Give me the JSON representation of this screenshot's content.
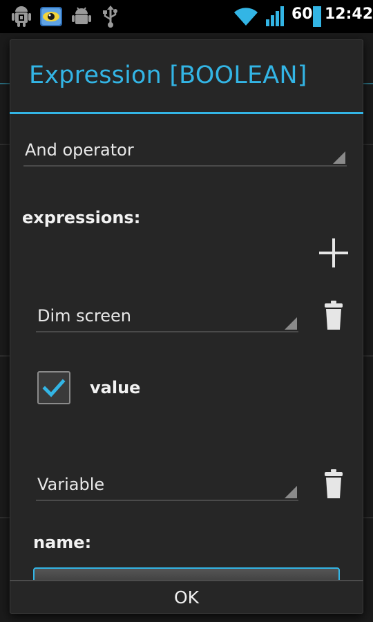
{
  "status_bar": {
    "battery": "60",
    "time": "12:42",
    "icons": [
      "android-icon",
      "eye-app-icon",
      "android-debug-icon",
      "usb-icon",
      "wifi-icon",
      "signal-icon",
      "battery-icon"
    ]
  },
  "dialog": {
    "title": "Expression [BOOLEAN]",
    "operator_spinner": {
      "value": "And operator"
    },
    "expressions_label": "expressions:",
    "items": [
      {
        "spinner_value": "Dim screen",
        "checkbox_label": "value",
        "checked": true
      },
      {
        "spinner_value": "Variable",
        "field_label": "name:"
      }
    ],
    "ok_label": "OK"
  },
  "colors": {
    "accent": "#33b5e5",
    "dialog_background": "#262626",
    "text": "#e8e8e8"
  }
}
